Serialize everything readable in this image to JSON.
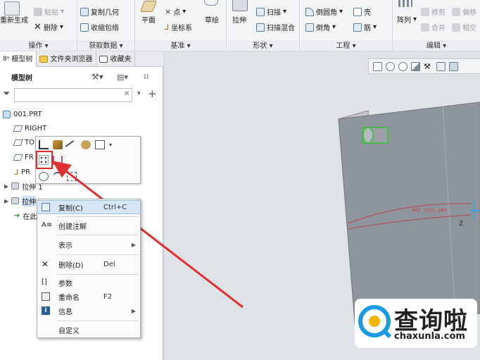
{
  "ribbon": {
    "regen_label": "重新生成",
    "paste_label": "粘贴",
    "delete_label": "删除",
    "copy_geom_label": "复制几何",
    "shrinkwrap_label": "收缩包络",
    "plane_label": "平面",
    "point_label": "点",
    "csys_label": "坐标系",
    "sketch_label": "草绘",
    "extrude_label": "拉伸",
    "sweep_label": "扫描",
    "swept_blend_label": "扫描混合",
    "round_label": "倒圆角",
    "chamfer_label": "倒角",
    "shell_label": "壳",
    "rib_label": "筋",
    "pattern_label": "阵列",
    "trim_label": "修剪",
    "offset_label": "偏移",
    "merge_label": "合并",
    "intersect_label": "相交",
    "groups": {
      "operations": "操作",
      "get_data": "获取数据",
      "datum": "基准",
      "shapes": "形状",
      "engineering": "工程",
      "editing": "编辑"
    }
  },
  "panel": {
    "tabs": [
      "模型树",
      "文件夹浏览器",
      "收藏夹"
    ],
    "tree_title": "模型树",
    "search_placeholder": "",
    "tree": {
      "part": "001.PRT",
      "right": "RIGHT",
      "top": "TO",
      "front": "FR",
      "prt_csys": "PR",
      "extrude1": "拉伸 1",
      "extrude2": "拉伸",
      "insert_here": "在此"
    }
  },
  "context_menu": {
    "items": [
      {
        "label": "复制(C)",
        "shortcut": "Ctrl+C"
      },
      {
        "label": "创建注解",
        "shortcut": ""
      },
      {
        "label": "表示",
        "shortcut": ""
      },
      {
        "label": "删除(D)",
        "shortcut": "Del"
      },
      {
        "label": "参数",
        "shortcut": ""
      },
      {
        "label": "重命名",
        "shortcut": "F2"
      },
      {
        "label": "信息",
        "shortcut": ""
      },
      {
        "label": "自定义",
        "shortcut": ""
      }
    ]
  },
  "viewport": {
    "csys_label": "PRT_CSYS_DEF",
    "axis_label": "Z"
  },
  "watermark": {
    "brand": "查询啦",
    "domain": "chaxunla.com"
  },
  "colors": {
    "accent_red": "#e02a2a",
    "hover_blue": "#d6e6f7",
    "model_gray": "#8f959c"
  }
}
